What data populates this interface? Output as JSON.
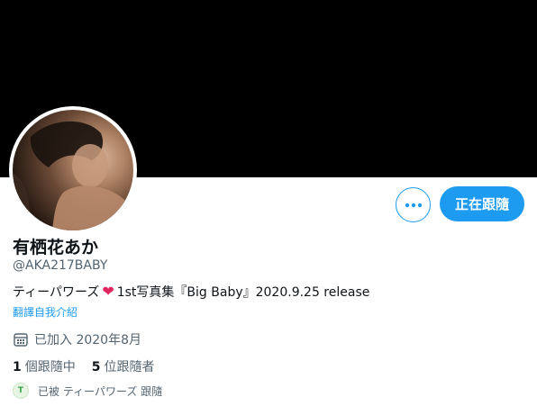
{
  "profile": {
    "display_name": "有栖花あか",
    "handle": "@AKA217BABY",
    "bio_before_heart": "ティーパワーズ",
    "bio_heart": "❤",
    "bio_after_heart": "1st写真集『Big Baby』2020.9.25 release",
    "translate_bio": "翻譯自我介紹",
    "joined": "已加入 2020年8月"
  },
  "actions": {
    "follow_label": "正在跟隨",
    "more_icon": "ellipsis-icon"
  },
  "stats": {
    "following_count": "1",
    "following_label": "個跟隨中",
    "followers_count": "5",
    "followers_label": "位跟隨者"
  },
  "followed_by": {
    "text": "已被 ティーパワーズ 跟隨",
    "mini_avatar_mark": "T"
  },
  "colors": {
    "accent": "#1d9bf0",
    "banner": "#000000",
    "heart": "#e0245e",
    "secondary_text": "#536471"
  }
}
